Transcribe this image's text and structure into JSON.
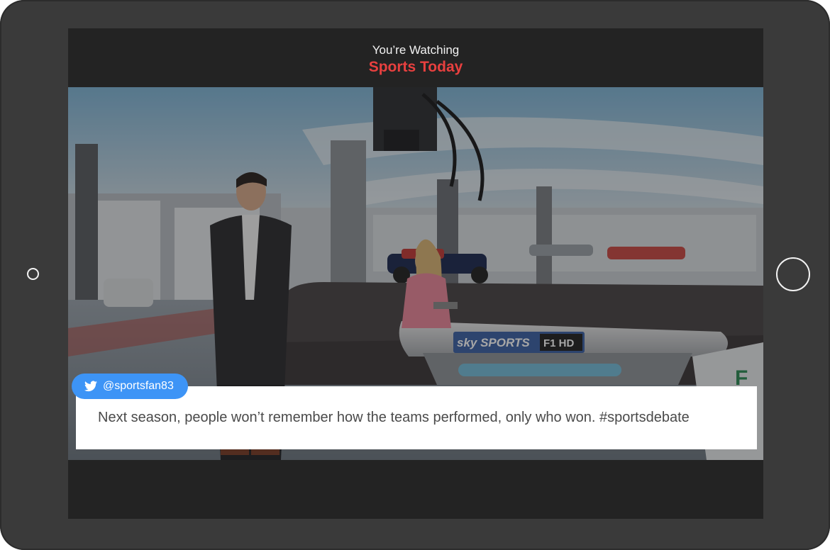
{
  "header": {
    "watching_label": "You’re Watching",
    "show_title": "Sports Today"
  },
  "tweet": {
    "handle": "@sportsfan83",
    "text": "Next season, people won’t remember how the teams performed, only who won. #sportsdebate"
  },
  "video_overlay": {
    "desk_brand": "SKY SPORTS F1 HD"
  },
  "colors": {
    "accent": "#e8403f",
    "twitter_blue": "#3d94f6",
    "device_frame": "#3a3a3a",
    "screen_bg": "#232323"
  },
  "icons": {
    "handle_icon": "twitter-bird-icon"
  }
}
